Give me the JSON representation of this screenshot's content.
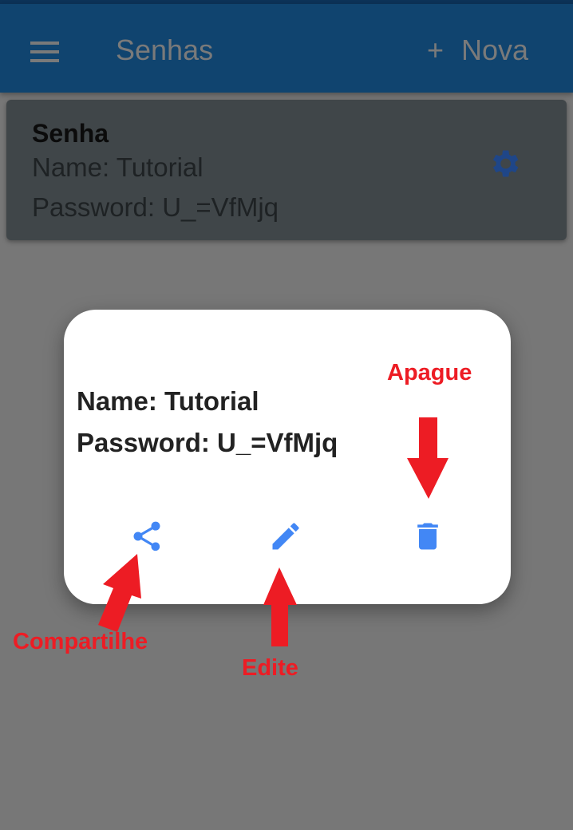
{
  "appbar": {
    "title": "Senhas",
    "add_icon": "+",
    "add_label": "Nova",
    "menu_icon": "hamburger-icon"
  },
  "card": {
    "heading": "Senha",
    "name": "Name: Tutorial",
    "password": "Password: U_=VfMjq",
    "settings_icon": "gear-icon"
  },
  "dialog": {
    "name": "Name: Tutorial",
    "password": "Password: U_=VfMjq",
    "actions": [
      "share-icon",
      "edit-icon",
      "delete-icon"
    ],
    "icon_color": "#4287f5"
  },
  "annotations": {
    "delete": "Apague",
    "share": "Compartilhe",
    "edit": "Edite",
    "color": "#ed1c24"
  }
}
